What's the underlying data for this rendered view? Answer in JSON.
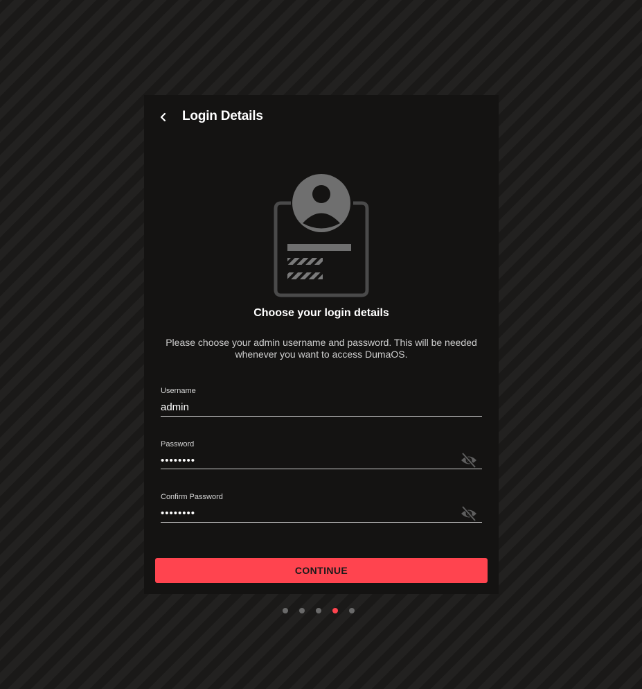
{
  "header": {
    "title": "Login Details",
    "back_icon": "chevron-left-icon"
  },
  "illustration": {
    "icon": "user-badge-icon"
  },
  "content": {
    "subtitle": "Choose your login details",
    "description": "Please choose your admin username and password. This will be needed whenever you want to access DumaOS."
  },
  "form": {
    "username": {
      "label": "Username",
      "value": "admin"
    },
    "password": {
      "label": "Password",
      "value": "••••••••",
      "toggle_icon": "eye-off-icon"
    },
    "confirm_password": {
      "label": "Confirm Password",
      "value": "••••••••",
      "toggle_icon": "eye-off-icon"
    }
  },
  "actions": {
    "continue_label": "CONTINUE"
  },
  "pagination": {
    "total_steps": 5,
    "current_step": 4
  },
  "colors": {
    "accent": "#ff444f",
    "card_bg": "#141312",
    "icon_gray": "#6f6f6f"
  }
}
